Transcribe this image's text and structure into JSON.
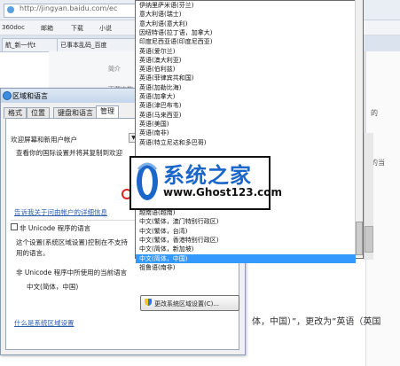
{
  "browser": {
    "url": "http://jingyan.baidu.com/ec",
    "bookmarks": [
      "360doc",
      "邮箱",
      "下载",
      "小说",
      "已事本乱码_百度"
    ],
    "tabs": [
      "航_新一代t"
    ]
  },
  "page_grid": {
    "cells": [
      "简介",
      "下载次数"
    ]
  },
  "right_page_text": [
    "的",
    "的当"
  ],
  "dialog": {
    "title": "区域和语言",
    "tabs": [
      "格式",
      "位置",
      "键盘和语言",
      "管理"
    ],
    "welcome_heading": "欢迎屏幕和新用户帐户",
    "welcome_desc": "查看你的国际设置并将其复制到欢迎",
    "link_more": "告诉我关于问由帐户的详细信息",
    "unicode_heading": "非 Unicode 程序的语言",
    "unicode_desc_1": "这个设置(系统区域设置)控制在不支持",
    "unicode_desc_2": "用的语言。",
    "current_label": "非 Unicode 程序中所使用的当前语言",
    "current_value": "中文(简体，中国)",
    "change_button": "更改系统区域设置(C)...",
    "link_what": "什么是系统区域设置"
  },
  "dropdown": {
    "items_top": [
      "伊纳里萨米语(芬兰)",
      "意大利语(瑞士)",
      "意大利语(意大利)",
      "因纽特语(拉丁语，加拿大)",
      "印度尼西亚语(印度尼西亚)",
      "英语(爱尔兰)",
      "英语(澳大利亚)",
      "英语(伯利兹)",
      "英语(菲律宾共和国)",
      "英语(加勒比海)",
      "英语(加拿大)",
      "英语(津巴布韦)",
      "英语(马来西亚)",
      "英语(美国)",
      "英语(南非)",
      "英语(特立尼达和多巴哥)"
    ],
    "items_bottom": [
      "越南语(越南)",
      "中文(繁体，澳门特别行政区)",
      "中文(繁体，台湾)",
      "中文(繁体，香港特别行政区)",
      "中文(简体，新加坡)",
      "中文(简体，中国)",
      "祖鲁语(南非)"
    ],
    "selected": "中文(简体，中国)"
  },
  "watermark": {
    "title": "系统之家",
    "url": "www.Ghost123.com"
  },
  "article": {
    "text": "体，中国）”，更改为”英语（英国"
  },
  "colors": {
    "selection": "#3399ff",
    "link": "#2a5db0",
    "watermark_blue": "#1a66c9"
  }
}
